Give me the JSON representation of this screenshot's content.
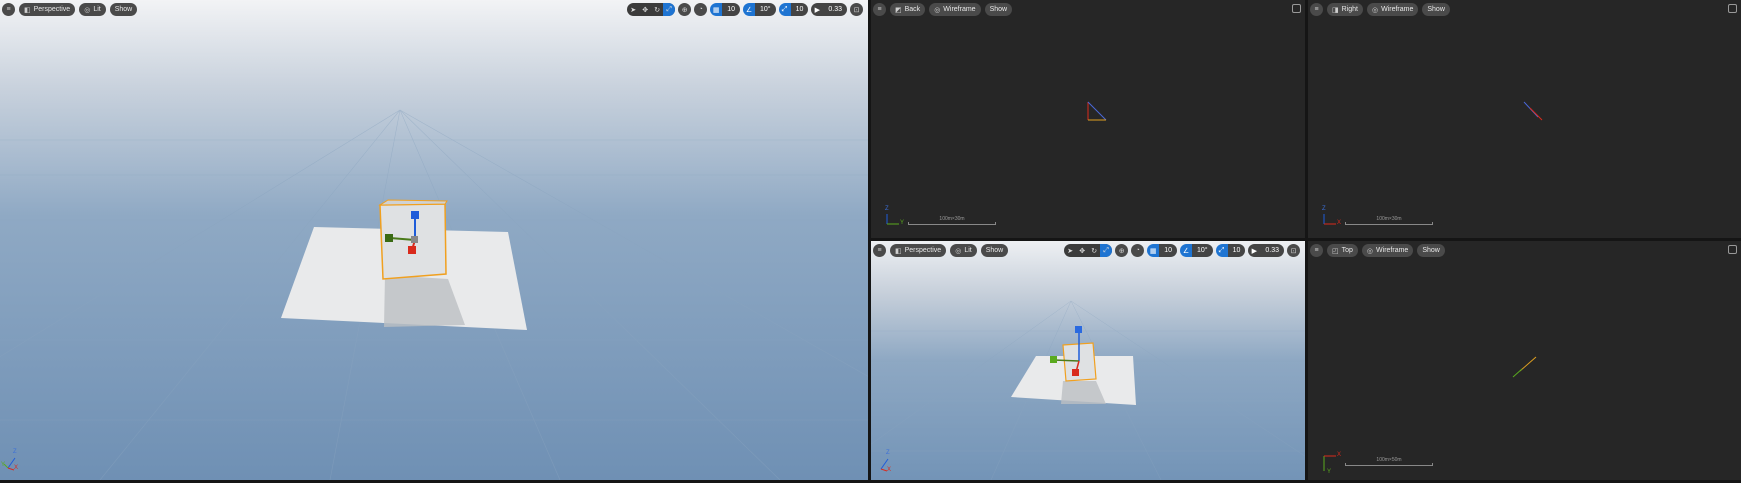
{
  "viewports": {
    "main": {
      "options_icon": "menu-icon",
      "view_mode": "Perspective",
      "lighting": "Lit",
      "show": "Show",
      "grid_snap": "10",
      "rotation_snap": "10°",
      "scale_snap": "10",
      "camera_speed": "0.33",
      "axis_labels": {
        "z": "Z",
        "x": "X",
        "y": "Y"
      }
    },
    "back": {
      "view_mode": "Back",
      "lighting": "Wireframe",
      "show": "Show",
      "scale_label": "100m×30m",
      "axis_labels": {
        "z": "Z",
        "y": "Y"
      }
    },
    "right": {
      "view_mode": "Right",
      "lighting": "Wireframe",
      "show": "Show",
      "scale_label": "100m×30m",
      "axis_labels": {
        "z": "Z",
        "x": "X"
      }
    },
    "perspective_small": {
      "view_mode": "Perspective",
      "lighting": "Lit",
      "show": "Show",
      "grid_snap": "10",
      "rotation_snap": "10°",
      "scale_snap": "10",
      "camera_speed": "0.33",
      "axis_labels": {
        "z": "Z",
        "x": "X"
      }
    },
    "top": {
      "view_mode": "Top",
      "lighting": "Wireframe",
      "show": "Show",
      "scale_label": "100m×50m",
      "axis_labels": {
        "x": "X",
        "y": "Y"
      }
    }
  },
  "colors": {
    "accent": "#1e74d2",
    "selection": "#f0a020",
    "axis_x": "#d92a1c",
    "axis_y": "#5aaa1e",
    "axis_z": "#1e5cd9"
  }
}
